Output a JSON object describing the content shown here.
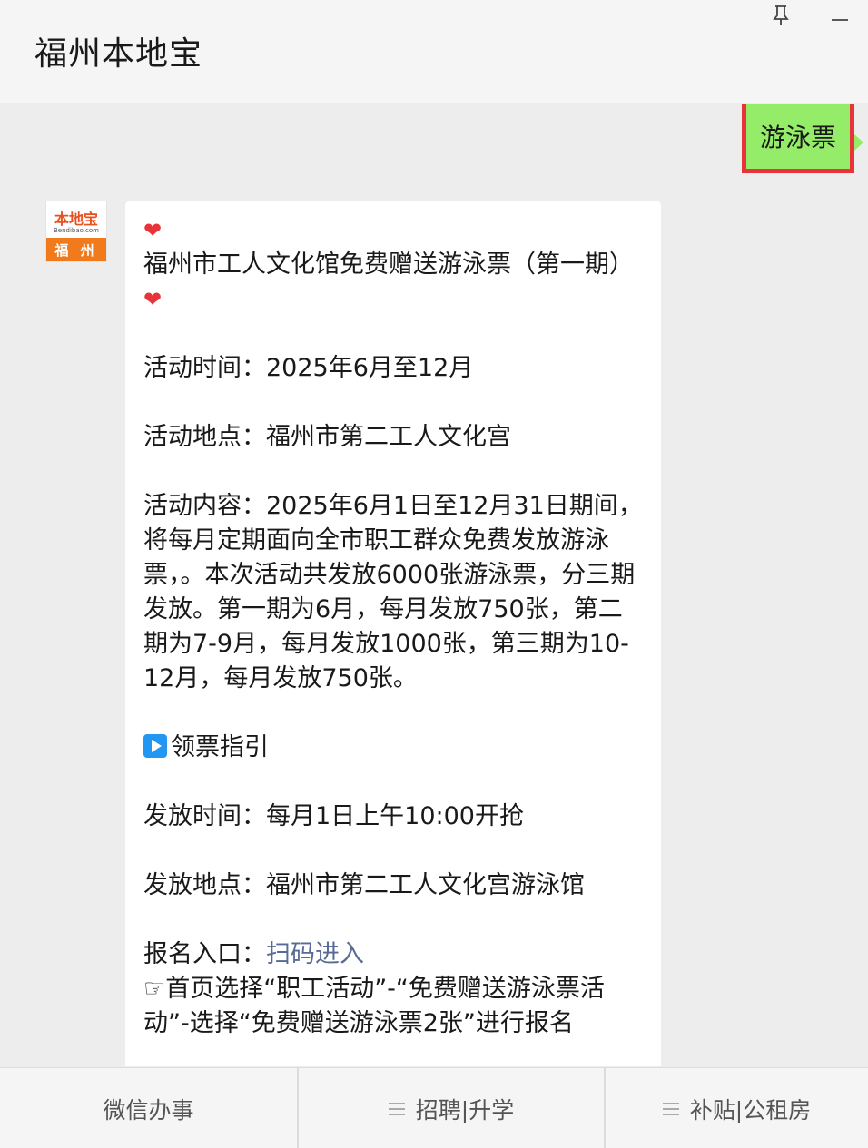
{
  "header": {
    "title": "福州本地宝"
  },
  "window_controls": {
    "pin_icon": "pin-icon",
    "minimize_icon": "minimize-icon"
  },
  "sent_message": {
    "text": "游泳票"
  },
  "avatar": {
    "logo_text": "本地宝",
    "logo_url": "Bendibao.com",
    "logo_city": "福 州"
  },
  "reply": {
    "heading": "福州市工人文化馆免费赠送游泳票（第一期）",
    "time": "活动时间：2025年6月至12月",
    "place": "活动地点：福州市第二工人文化宫",
    "content": "活动内容：2025年6月1日至12月31日期间，将每月定期面向全市职工群众免费发放游泳票，。本次活动共发放6000张游泳票，分三期发放。第一期为6月，每月发放750张，第二期为7-9月，每月发放1000张，第三期为10-12月，每月发放750张。",
    "guide_title": "领票指引",
    "issue_time": "发放时间：每月1日上午10:00开抢",
    "issue_place": "发放地点：福州市第二工人文化宫游泳馆",
    "signup_label": "报名入口：",
    "signup_link": "扫码进入",
    "steps": "☞首页选择“职工活动”-“免费赠送游泳票活动”-选择“免费赠送游泳票2张”进行报名"
  },
  "footer": {
    "tabs": [
      "微信办事",
      "招聘|升学",
      "补贴|公租房"
    ]
  },
  "colors": {
    "sent_bubble": "#95ec69",
    "highlight_box": "#e8333a",
    "link": "#576b95"
  }
}
